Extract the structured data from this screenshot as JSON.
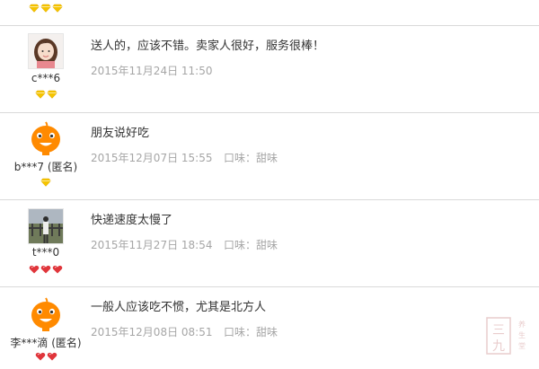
{
  "reviews": [
    {
      "username": "",
      "avatar": "none",
      "badge_type": "diamond-gold",
      "badge_count": 3
    },
    {
      "username": "c***6",
      "avatar": "girl-photo",
      "badge_type": "diamond-gold",
      "badge_count": 2,
      "text": "送人的，应该不错。卖家人很好，服务很棒！",
      "date": "2015年11月24日 11:50",
      "taste": ""
    },
    {
      "username": "b***7 (匿名)",
      "avatar": "orange-mascot",
      "badge_type": "diamond-gold",
      "badge_count": 1,
      "text": "朋友说好吃",
      "date": "2015年12月07日 15:55",
      "taste": "口味：甜味"
    },
    {
      "username": "t***0",
      "avatar": "outdoor-photo",
      "badge_type": "heart-red",
      "badge_count": 3,
      "text": "快递速度太慢了",
      "date": "2015年11月27日 18:54",
      "taste": "口味：甜味"
    },
    {
      "username": "李***滴 (匿名)",
      "avatar": "orange-mascot",
      "badge_type": "heart-red",
      "badge_count": 2,
      "text": "一般人应该吃不惯，尤其是北方人",
      "date": "2015年12月08日 08:51",
      "taste": "口味：甜味"
    }
  ],
  "watermark": {
    "icon": "seal-stamp",
    "text": "三九养生堂"
  },
  "colors": {
    "divider": "#d9d9d9",
    "meta_text": "#a6a6a6",
    "body_text": "#333333",
    "badge_gold": "#f5c400",
    "badge_red": "#e0353b",
    "mascot_orange": "#ff8a00"
  }
}
